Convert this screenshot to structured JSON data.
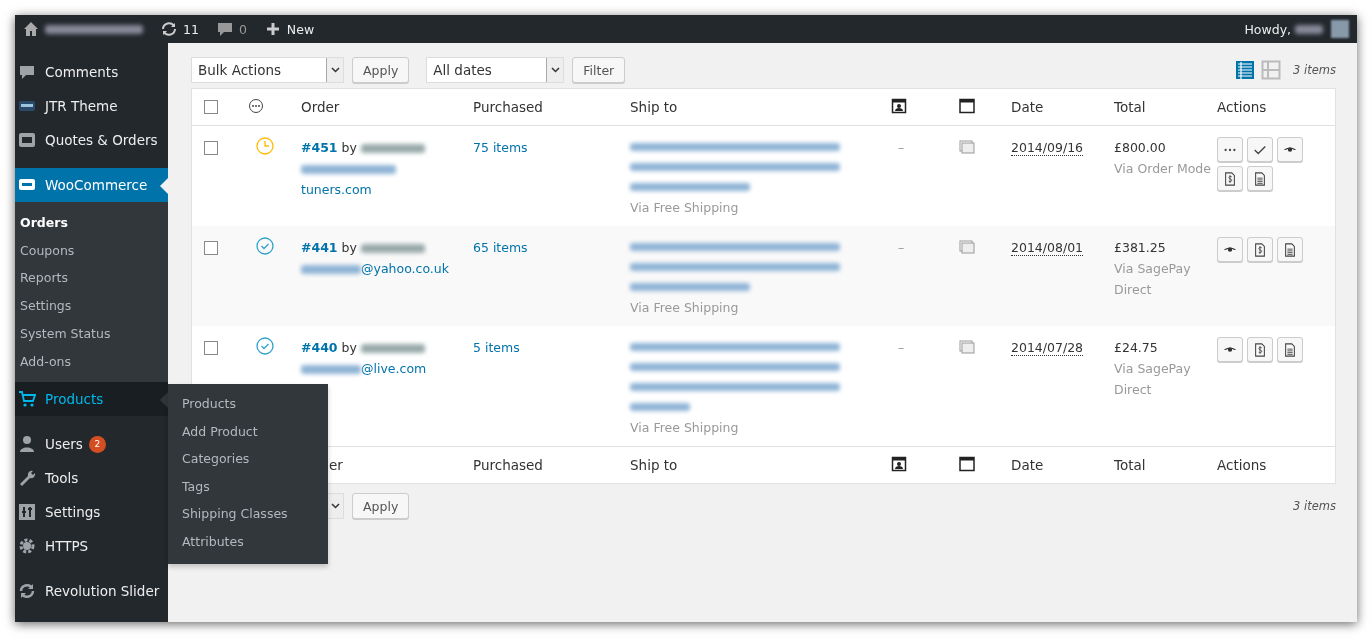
{
  "admin_bar": {
    "updates": "11",
    "comments": "0",
    "new": "New",
    "greeting": "Howdy,"
  },
  "sidebar": {
    "items": [
      {
        "kind": "item",
        "label": "Comments",
        "selected": false,
        "hovered": false
      },
      {
        "kind": "item",
        "label": "JTR Theme",
        "selected": false,
        "hovered": false
      },
      {
        "kind": "item",
        "label": "Quotes & Orders",
        "selected": false,
        "hovered": false
      },
      {
        "kind": "separator"
      },
      {
        "kind": "item",
        "label": "WooCommerce",
        "selected": true,
        "hovered": false,
        "children": [
          {
            "label": "Orders",
            "selected": true
          },
          {
            "label": "Coupons",
            "selected": false
          },
          {
            "label": "Reports",
            "selected": false
          },
          {
            "label": "Settings",
            "selected": false
          },
          {
            "label": "System Status",
            "selected": false
          },
          {
            "label": "Add-ons",
            "selected": false
          }
        ]
      },
      {
        "kind": "item",
        "label": "Products",
        "selected": false,
        "hovered": true,
        "flyout": [
          "Products",
          "Add Product",
          "Categories",
          "Tags",
          "Shipping Classes",
          "Attributes"
        ]
      },
      {
        "kind": "separator"
      },
      {
        "kind": "item",
        "label": "Users",
        "selected": false,
        "hovered": false,
        "badge": "2"
      },
      {
        "kind": "item",
        "label": "Tools",
        "selected": false,
        "hovered": false
      },
      {
        "kind": "item",
        "label": "Settings",
        "selected": false,
        "hovered": false
      },
      {
        "kind": "item",
        "label": "HTTPS",
        "selected": false,
        "hovered": false
      },
      {
        "kind": "separator"
      },
      {
        "kind": "item",
        "label": "Revolution Slider",
        "selected": false,
        "hovered": false
      }
    ]
  },
  "toolbar": {
    "bulk_actions": "Bulk Actions",
    "apply": "Apply",
    "dates": "All dates",
    "filter": "Filter",
    "views": [
      {
        "kind": "list",
        "selected": true
      },
      {
        "kind": "excerpt",
        "selected": false
      }
    ],
    "count": "3 items"
  },
  "table": {
    "header_checked": false,
    "columns": [
      {
        "kind": "checkbox"
      },
      {
        "kind": "status"
      },
      {
        "kind": "text",
        "label": "Order"
      },
      {
        "kind": "text",
        "label": "Purchased"
      },
      {
        "kind": "text",
        "label": "Ship to"
      },
      {
        "kind": "message"
      },
      {
        "kind": "notes"
      },
      {
        "kind": "text",
        "label": "Date"
      },
      {
        "kind": "text",
        "label": "Total"
      },
      {
        "kind": "text",
        "label": "Actions"
      }
    ],
    "rows": [
      {
        "checked": false,
        "kind": "pending",
        "order": "#451",
        "by": "by",
        "email": "tuners.com",
        "email_inline": false,
        "purchased": "75 items",
        "shipping": "Via Free Shipping",
        "message": "–",
        "date": "2014/09/16",
        "total": "£800.00",
        "payment": "Via Order Mode",
        "actions": [
          {
            "kind": "more"
          },
          {
            "kind": "complete"
          },
          {
            "kind": "view"
          },
          {
            "kind": "invoice"
          },
          {
            "kind": "slip"
          }
        ]
      },
      {
        "checked": false,
        "kind": "completed",
        "order": "#441",
        "by": "by",
        "email": "@yahoo.co.uk",
        "email_inline": true,
        "purchased": "65 items",
        "shipping": "Via Free Shipping",
        "message": "–",
        "date": "2014/08/01",
        "total": "£381.25",
        "payment": "Via SagePay Direct",
        "actions": [
          {
            "kind": "view"
          },
          {
            "kind": "invoice"
          },
          {
            "kind": "slip"
          }
        ]
      },
      {
        "checked": false,
        "kind": "completed",
        "order": "#440",
        "by": "by",
        "email": "@live.com",
        "email_inline": true,
        "purchased": "5 items",
        "shipping": "Via Free Shipping",
        "message": "–",
        "date": "2014/07/28",
        "total": "£24.75",
        "payment": "Via SagePay Direct",
        "actions": [
          {
            "kind": "view"
          },
          {
            "kind": "invoice"
          },
          {
            "kind": "slip"
          }
        ]
      }
    ],
    "footer_columns": [
      {
        "kind": "hidden"
      },
      {
        "kind": "hidden"
      },
      {
        "kind": "cut",
        "label": "er"
      },
      {
        "kind": "text",
        "label": "Purchased"
      },
      {
        "kind": "text",
        "label": "Ship to"
      },
      {
        "kind": "message"
      },
      {
        "kind": "notes"
      },
      {
        "kind": "text",
        "label": "Date"
      },
      {
        "kind": "text",
        "label": "Total"
      },
      {
        "kind": "text",
        "label": "Actions"
      }
    ]
  },
  "bottom_toolbar": {
    "apply": "Apply",
    "count": "3 items"
  }
}
